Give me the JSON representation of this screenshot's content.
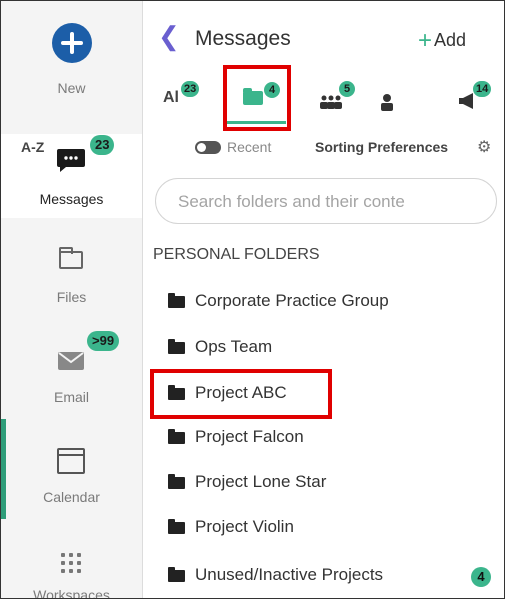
{
  "rail": {
    "new_label": "New",
    "messages_label": "Messages",
    "messages_badge": "23",
    "files_label": "Files",
    "email_label": "Email",
    "email_badge": ">99",
    "calendar_label": "Calendar",
    "workspaces_label": "Workspaces"
  },
  "header": {
    "title": "Messages",
    "add_label": "Add",
    "back_icon": "chevron-left-icon"
  },
  "tabs": [
    {
      "label": "Al",
      "badge": "23"
    },
    {
      "label": "",
      "badge": "4",
      "icon": "folder-icon"
    },
    {
      "label": "",
      "badge": "5",
      "icon": "group-icon"
    },
    {
      "label": "",
      "badge": "",
      "icon": "person-icon"
    },
    {
      "label": "",
      "badge": "14",
      "icon": "megaphone-icon"
    }
  ],
  "sort": {
    "az": "A-Z",
    "recent": "Recent",
    "prefs": "Sorting Preferences"
  },
  "search": {
    "placeholder": "Search folders and their conte"
  },
  "section_title": "PERSONAL FOLDERS",
  "folders": [
    {
      "name": "Corporate Practice Group",
      "badge": ""
    },
    {
      "name": "Ops Team",
      "badge": ""
    },
    {
      "name": "Project ABC",
      "badge": ""
    },
    {
      "name": "Project Falcon",
      "badge": ""
    },
    {
      "name": "Project Lone Star",
      "badge": ""
    },
    {
      "name": "Project Violin",
      "badge": ""
    },
    {
      "name": "Unused/Inactive Projects",
      "badge": "4"
    }
  ],
  "colors": {
    "accent": "#3bb58c",
    "brand": "#1c5ea8",
    "highlight": "#e00000",
    "chevron": "#6a5fd0"
  }
}
